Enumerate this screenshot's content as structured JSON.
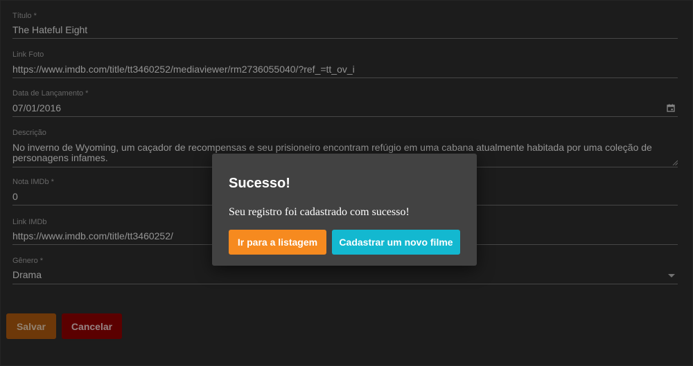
{
  "form": {
    "title_field": {
      "label": "Título *",
      "value": "The Hateful Eight"
    },
    "photo_field": {
      "label": "Link Foto",
      "value": "https://www.imdb.com/title/tt3460252/mediaviewer/rm2736055040/?ref_=tt_ov_i"
    },
    "release_field": {
      "label": "Data de Lançamento *",
      "value": "07/01/2016"
    },
    "description_field": {
      "label": "Descrição",
      "value": "No inverno de Wyoming, um caçador de recompensas e seu prisioneiro encontram refúgio em uma cabana atualmente habitada por uma coleção de personagens infames."
    },
    "rating_field": {
      "label": "Nota IMDb *",
      "value": "0"
    },
    "imdb_link_field": {
      "label": "Link IMDb",
      "value": "https://www.imdb.com/title/tt3460252/"
    },
    "genre_field": {
      "label": "Gênero *",
      "value": "Drama"
    }
  },
  "actions": {
    "save_label": "Salvar",
    "cancel_label": "Cancelar"
  },
  "dialog": {
    "title": "Sucesso!",
    "message": "Seu registro foi cadastrado com sucesso!",
    "go_to_list_label": "Ir para a listagem",
    "new_movie_label": "Cadastrar um novo filme"
  },
  "colors": {
    "orange": "#f68a1f",
    "cyan": "#13b8d0",
    "save_dim": "#a8560f",
    "cancel_dim": "#8d0000",
    "background": "#2b2b2b"
  },
  "icons": {
    "calendar": "calendar-icon",
    "dropdown": "chevron-down-icon"
  }
}
